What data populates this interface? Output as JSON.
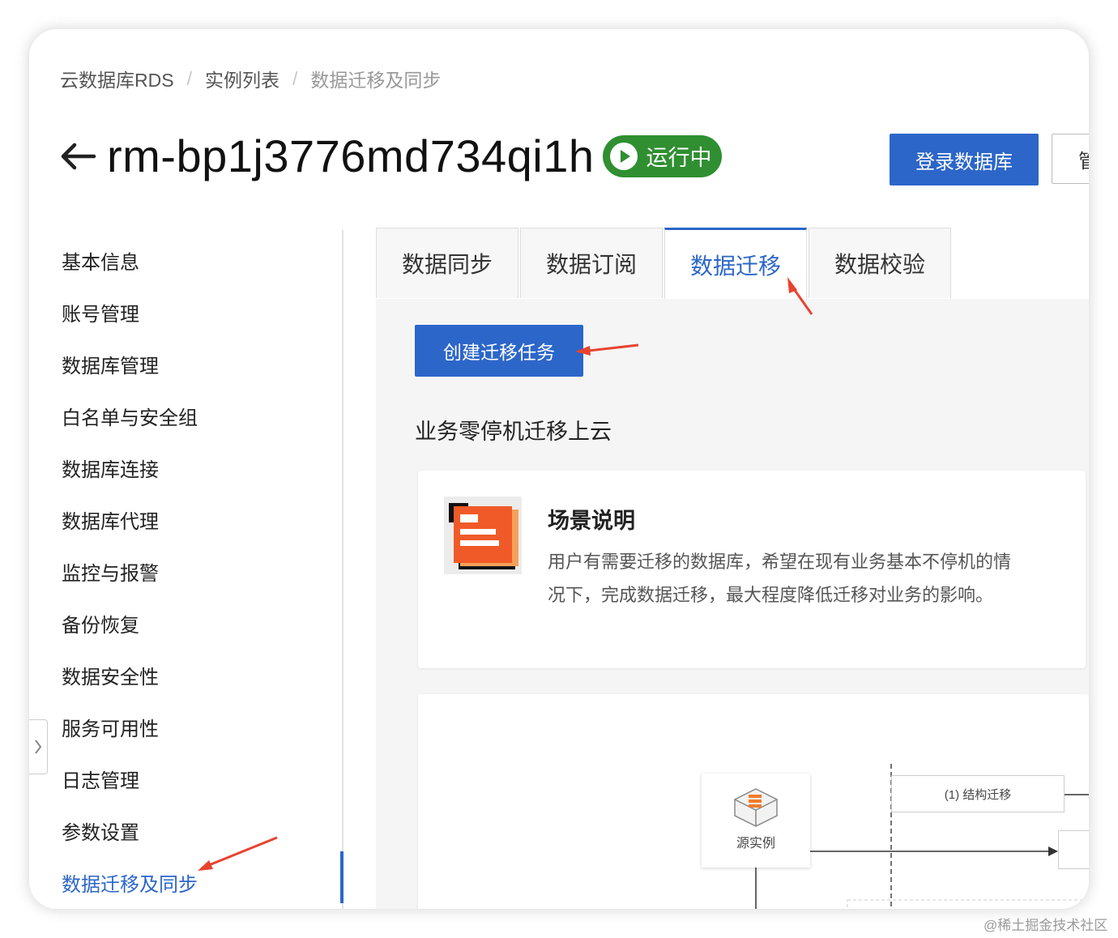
{
  "breadcrumb": {
    "items": [
      "云数据库RDS",
      "实例列表"
    ],
    "current": "数据迁移及同步",
    "separator": "/"
  },
  "header": {
    "instance_id": "rm-bp1j3776md734qi1h",
    "status": "运行中",
    "login_button": "登录数据库",
    "manage_button": "管"
  },
  "sidebar": {
    "items": [
      "基本信息",
      "账号管理",
      "数据库管理",
      "白名单与安全组",
      "数据库连接",
      "数据库代理",
      "监控与报警",
      "备份恢复",
      "数据安全性",
      "服务可用性",
      "日志管理",
      "参数设置",
      "数据迁移及同步"
    ],
    "active_index": 12
  },
  "tabs": {
    "items": [
      "数据同步",
      "数据订阅",
      "数据迁移",
      "数据校验"
    ],
    "active_index": 2
  },
  "main": {
    "create_button": "创建迁移任务",
    "section_title": "业务零停机迁移上云",
    "scene": {
      "title": "场景说明",
      "desc_line1": "用户有需要迁移的数据库，希望在现有业务基本不停机的情",
      "desc_line2": "况下，完成数据迁移，最大程度降低迁移对业务的影响。"
    },
    "diagram": {
      "source_label": "源实例",
      "step1": "(1) 结构迁移"
    }
  },
  "watermark": "@稀土掘金技术社区",
  "colors": {
    "primary": "#2c66c9",
    "status_green": "#2f8f31",
    "arrow_red": "#e8432e",
    "scene_orange": "#f05a28"
  }
}
